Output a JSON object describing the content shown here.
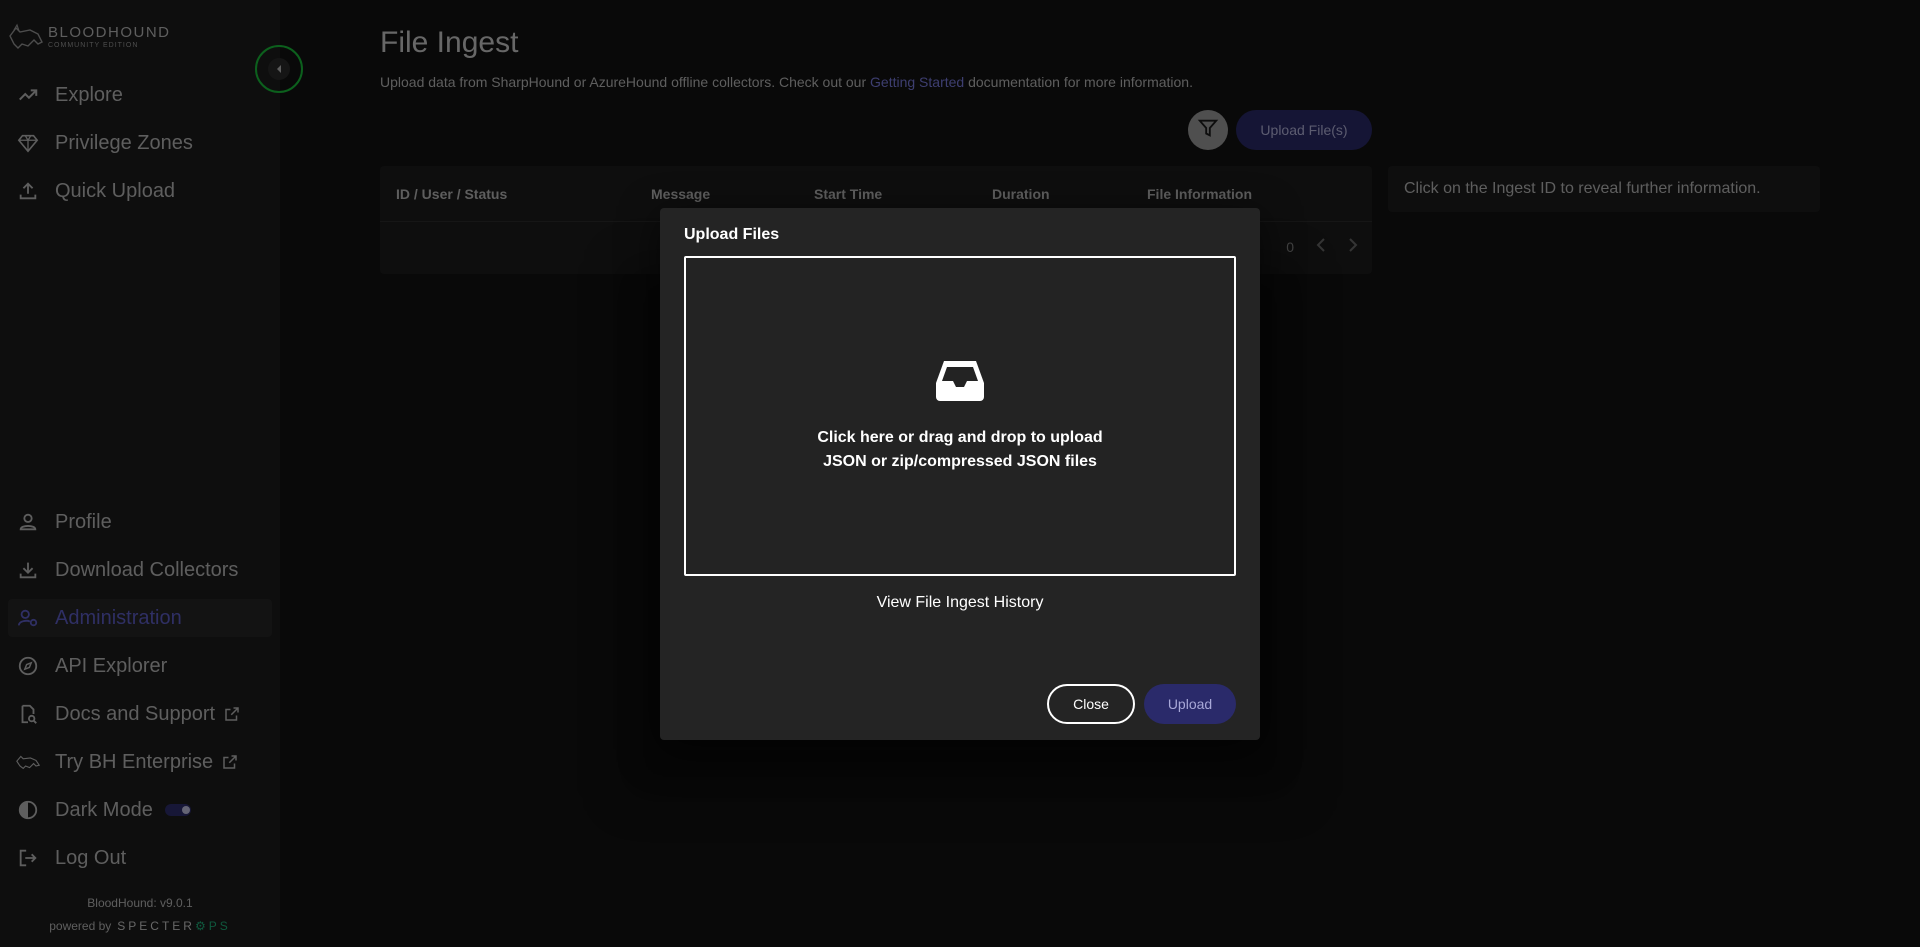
{
  "brand": {
    "name": "BLOODHOUND",
    "subtitle": "COMMUNITY EDITION"
  },
  "sidebar": {
    "top_items": [
      {
        "label": "Explore",
        "icon": "chart-line-icon"
      },
      {
        "label": "Privilege Zones",
        "icon": "gem-icon"
      },
      {
        "label": "Quick Upload",
        "icon": "upload-icon"
      }
    ],
    "bottom_items": [
      {
        "label": "Profile",
        "icon": "person-icon"
      },
      {
        "label": "Download Collectors",
        "icon": "download-icon"
      },
      {
        "label": "Administration",
        "icon": "admin-icon",
        "active": true
      },
      {
        "label": "API Explorer",
        "icon": "compass-icon"
      },
      {
        "label": "Docs and Support",
        "icon": "doc-search-icon"
      },
      {
        "label": "Try BH Enterprise",
        "icon": "bloodhound-icon"
      },
      {
        "label": "Dark Mode",
        "icon": "contrast-icon"
      },
      {
        "label": "Log Out",
        "icon": "logout-icon"
      }
    ],
    "version": "BloodHound: v9.0.1",
    "powered_by": "powered by",
    "powered_brand_a": "SPECTER",
    "powered_brand_b": "PS"
  },
  "main": {
    "title": "File Ingest",
    "desc_pre": "Upload data from SharpHound or AzureHound offline collectors. Check out our ",
    "desc_link": "Getting Started",
    "desc_post": " documentation for more information.",
    "upload_button": "Upload File(s)",
    "table_headers": [
      "ID / User / Status",
      "Message",
      "Start Time",
      "Duration",
      "File Information"
    ],
    "pagination_count": "0",
    "info_text": "Click on the Ingest ID to reveal further information."
  },
  "modal": {
    "title": "Upload Files",
    "drop_line1": "Click here or drag and drop to upload",
    "drop_line2": "JSON or zip/compressed JSON files",
    "history_link": "View File Ingest History",
    "close_label": "Close",
    "upload_label": "Upload"
  },
  "colors": {
    "accent": "#5e5fc9",
    "primary_button": "#2a2a6a",
    "focus_ring": "#19c03a"
  }
}
